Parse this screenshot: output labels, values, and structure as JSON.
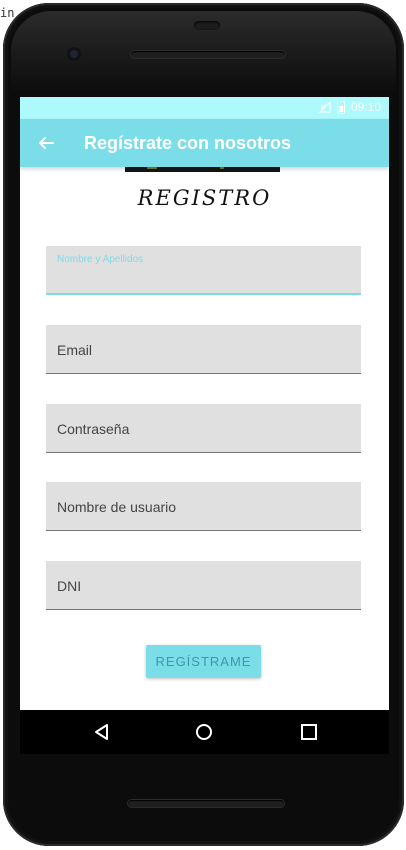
{
  "corner_text": "in",
  "status_bar": {
    "time": "09:10",
    "background_color": "#adf9fb"
  },
  "app_bar": {
    "title": "Regístrate con nosotros",
    "back_icon": "arrow-left-icon",
    "background_color": "#7adde8"
  },
  "header": {
    "title": "REGISTRO"
  },
  "form": {
    "fields": [
      {
        "label": "Nombre y Apellidos",
        "value": "",
        "focused": true
      },
      {
        "label": "Email",
        "value": ""
      },
      {
        "label": "Contraseña",
        "value": ""
      },
      {
        "label": "Nombre de usuario",
        "value": ""
      },
      {
        "label": "DNI",
        "value": ""
      }
    ],
    "submit_label": "REGÍSTRAME"
  },
  "nav_bar": {
    "back_icon": "triangle-back-icon",
    "home_icon": "circle-home-icon",
    "recents_icon": "square-recents-icon"
  }
}
